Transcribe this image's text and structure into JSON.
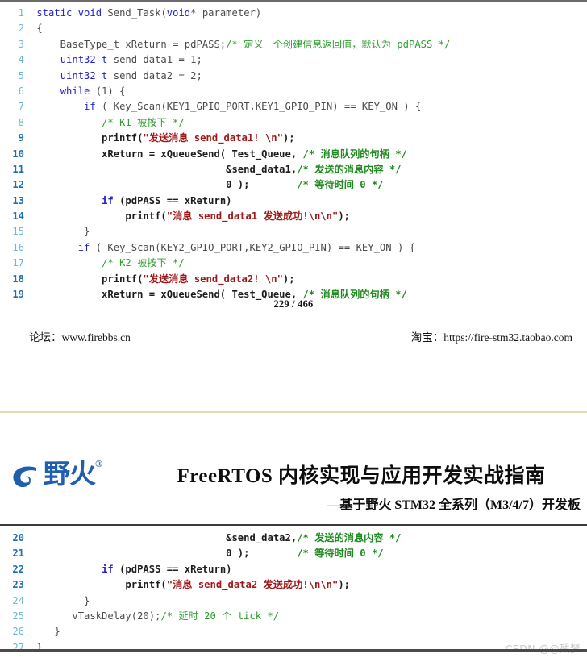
{
  "document": {
    "page_number_label": "229 / 466",
    "page_current": "229",
    "page_total": "466"
  },
  "page_one": {
    "footer": {
      "left": "论坛：www.firebbs.cn",
      "right": "淘宝：https://fire-stm32.taobao.com"
    },
    "code": [
      {
        "n": "1",
        "bold": false,
        "tokens": [
          {
            "t": "plain",
            "s": " "
          },
          {
            "t": "kw",
            "s": "static"
          },
          {
            "t": "plain",
            "s": " "
          },
          {
            "t": "kw",
            "s": "void"
          },
          {
            "t": "plain",
            "s": " Send_Task("
          },
          {
            "t": "kw",
            "s": "void"
          },
          {
            "t": "plain",
            "s": "* parameter)"
          }
        ]
      },
      {
        "n": "2",
        "bold": false,
        "tokens": [
          {
            "t": "plain",
            "s": " {"
          }
        ]
      },
      {
        "n": "3",
        "bold": false,
        "tokens": [
          {
            "t": "plain",
            "s": "     BaseType_t xReturn = pdPASS;"
          },
          {
            "t": "cmt",
            "s": "/* 定义一个创建信息返回值，默认为 pdPASS */"
          }
        ]
      },
      {
        "n": "4",
        "bold": false,
        "tokens": [
          {
            "t": "plain",
            "s": "     "
          },
          {
            "t": "kw",
            "s": "uint32_t"
          },
          {
            "t": "plain",
            "s": " send_data1 = 1;"
          }
        ]
      },
      {
        "n": "5",
        "bold": false,
        "tokens": [
          {
            "t": "plain",
            "s": "     "
          },
          {
            "t": "kw",
            "s": "uint32_t"
          },
          {
            "t": "plain",
            "s": " send_data2 = 2;"
          }
        ]
      },
      {
        "n": "6",
        "bold": false,
        "tokens": [
          {
            "t": "plain",
            "s": "     "
          },
          {
            "t": "kw",
            "s": "while"
          },
          {
            "t": "plain",
            "s": " (1) {"
          }
        ]
      },
      {
        "n": "7",
        "bold": false,
        "tokens": [
          {
            "t": "plain",
            "s": "         "
          },
          {
            "t": "kw",
            "s": "if"
          },
          {
            "t": "plain",
            "s": " ( Key_Scan(KEY1_GPIO_PORT,KEY1_GPIO_PIN) == KEY_ON ) {"
          }
        ]
      },
      {
        "n": "8",
        "bold": false,
        "tokens": [
          {
            "t": "plain",
            "s": "            "
          },
          {
            "t": "cmt",
            "s": "/* K1 被按下 */"
          }
        ]
      },
      {
        "n": "9",
        "bold": true,
        "tokens": [
          {
            "t": "plain-b",
            "s": "            printf("
          },
          {
            "t": "str",
            "s": "\"发送消息 send_data1! \\n\""
          },
          {
            "t": "plain-b",
            "s": ");"
          }
        ]
      },
      {
        "n": "10",
        "bold": true,
        "tokens": [
          {
            "t": "plain-b",
            "s": "            xReturn = xQueueSend( Test_Queue, "
          },
          {
            "t": "cmt-b",
            "s": "/* 消息队列的句柄 */"
          }
        ]
      },
      {
        "n": "11",
        "bold": true,
        "tokens": [
          {
            "t": "plain-b",
            "s": "                                 &send_data1,"
          },
          {
            "t": "cmt-b",
            "s": "/* 发送的消息内容 */"
          }
        ]
      },
      {
        "n": "12",
        "bold": true,
        "tokens": [
          {
            "t": "plain-b",
            "s": "                                 0 );        "
          },
          {
            "t": "cmt-b",
            "s": "/* 等待时间 0 */"
          }
        ]
      },
      {
        "n": "13",
        "bold": true,
        "tokens": [
          {
            "t": "plain-b",
            "s": "            "
          },
          {
            "t": "kw-b",
            "s": "if"
          },
          {
            "t": "plain-b",
            "s": " (pdPASS == xReturn)"
          }
        ]
      },
      {
        "n": "14",
        "bold": true,
        "tokens": [
          {
            "t": "plain-b",
            "s": "                printf("
          },
          {
            "t": "str",
            "s": "\"消息 send_data1 发送成功!\\n\\n\""
          },
          {
            "t": "plain-b",
            "s": ");"
          }
        ]
      },
      {
        "n": "15",
        "bold": false,
        "tokens": [
          {
            "t": "plain",
            "s": "         }"
          }
        ]
      },
      {
        "n": "16",
        "bold": false,
        "tokens": [
          {
            "t": "plain",
            "s": "        "
          },
          {
            "t": "kw",
            "s": "if"
          },
          {
            "t": "plain",
            "s": " ( Key_Scan(KEY2_GPIO_PORT,KEY2_GPIO_PIN) == KEY_ON ) {"
          }
        ]
      },
      {
        "n": "17",
        "bold": false,
        "tokens": [
          {
            "t": "plain",
            "s": "            "
          },
          {
            "t": "cmt",
            "s": "/* K2 被按下 */"
          }
        ]
      },
      {
        "n": "18",
        "bold": true,
        "tokens": [
          {
            "t": "plain-b",
            "s": "            printf("
          },
          {
            "t": "str",
            "s": "\"发送消息 send_data2! \\n\""
          },
          {
            "t": "plain-b",
            "s": ");"
          }
        ]
      },
      {
        "n": "19",
        "bold": true,
        "tokens": [
          {
            "t": "plain-b",
            "s": "            xReturn = xQueueSend( Test_Queue, "
          },
          {
            "t": "cmt-b",
            "s": "/* 消息队列的句柄 */"
          }
        ]
      }
    ]
  },
  "page_two": {
    "brand": {
      "logo_text": "野火",
      "registered_mark": "®"
    },
    "title": "FreeRTOS 内核实现与应用开发实战指南",
    "subtitle": "—基于野火 STM32 全系列（M3/4/7）开发板",
    "watermark": "CSDN @@残梦",
    "code": [
      {
        "n": "20",
        "bold": true,
        "tokens": [
          {
            "t": "plain-b",
            "s": "                                 &send_data2,"
          },
          {
            "t": "cmt-b",
            "s": "/* 发送的消息内容 */"
          }
        ]
      },
      {
        "n": "21",
        "bold": true,
        "tokens": [
          {
            "t": "plain-b",
            "s": "                                 0 );        "
          },
          {
            "t": "cmt-b",
            "s": "/* 等待时间 0 */"
          }
        ]
      },
      {
        "n": "22",
        "bold": true,
        "tokens": [
          {
            "t": "plain-b",
            "s": "            "
          },
          {
            "t": "kw-b",
            "s": "if"
          },
          {
            "t": "plain-b",
            "s": " (pdPASS == xReturn)"
          }
        ]
      },
      {
        "n": "23",
        "bold": true,
        "tokens": [
          {
            "t": "plain-b",
            "s": "                printf("
          },
          {
            "t": "str",
            "s": "\"消息 send_data2 发送成功!\\n\\n\""
          },
          {
            "t": "plain-b",
            "s": ");"
          }
        ]
      },
      {
        "n": "24",
        "bold": false,
        "tokens": [
          {
            "t": "plain",
            "s": "         }"
          }
        ]
      },
      {
        "n": "25",
        "bold": false,
        "tokens": [
          {
            "t": "plain",
            "s": "       vTaskDelay(20);"
          },
          {
            "t": "cmt",
            "s": "/* 延时 20 个 tick */"
          }
        ]
      },
      {
        "n": "26",
        "bold": false,
        "tokens": [
          {
            "t": "plain",
            "s": "    }"
          }
        ]
      },
      {
        "n": "27",
        "bold": false,
        "tokens": [
          {
            "t": "plain",
            "s": " }"
          }
        ]
      }
    ]
  },
  "colors": {
    "keyword": "#2323c8",
    "comment": "#2f9e2f",
    "string": "#a01818",
    "line_number": "#6bb8d6",
    "line_number_bold": "#1f6fb2",
    "brand_blue": "#1f5fae",
    "watermark_gray": "#c9c9c9",
    "separator_tan": "#e6d9b8"
  }
}
